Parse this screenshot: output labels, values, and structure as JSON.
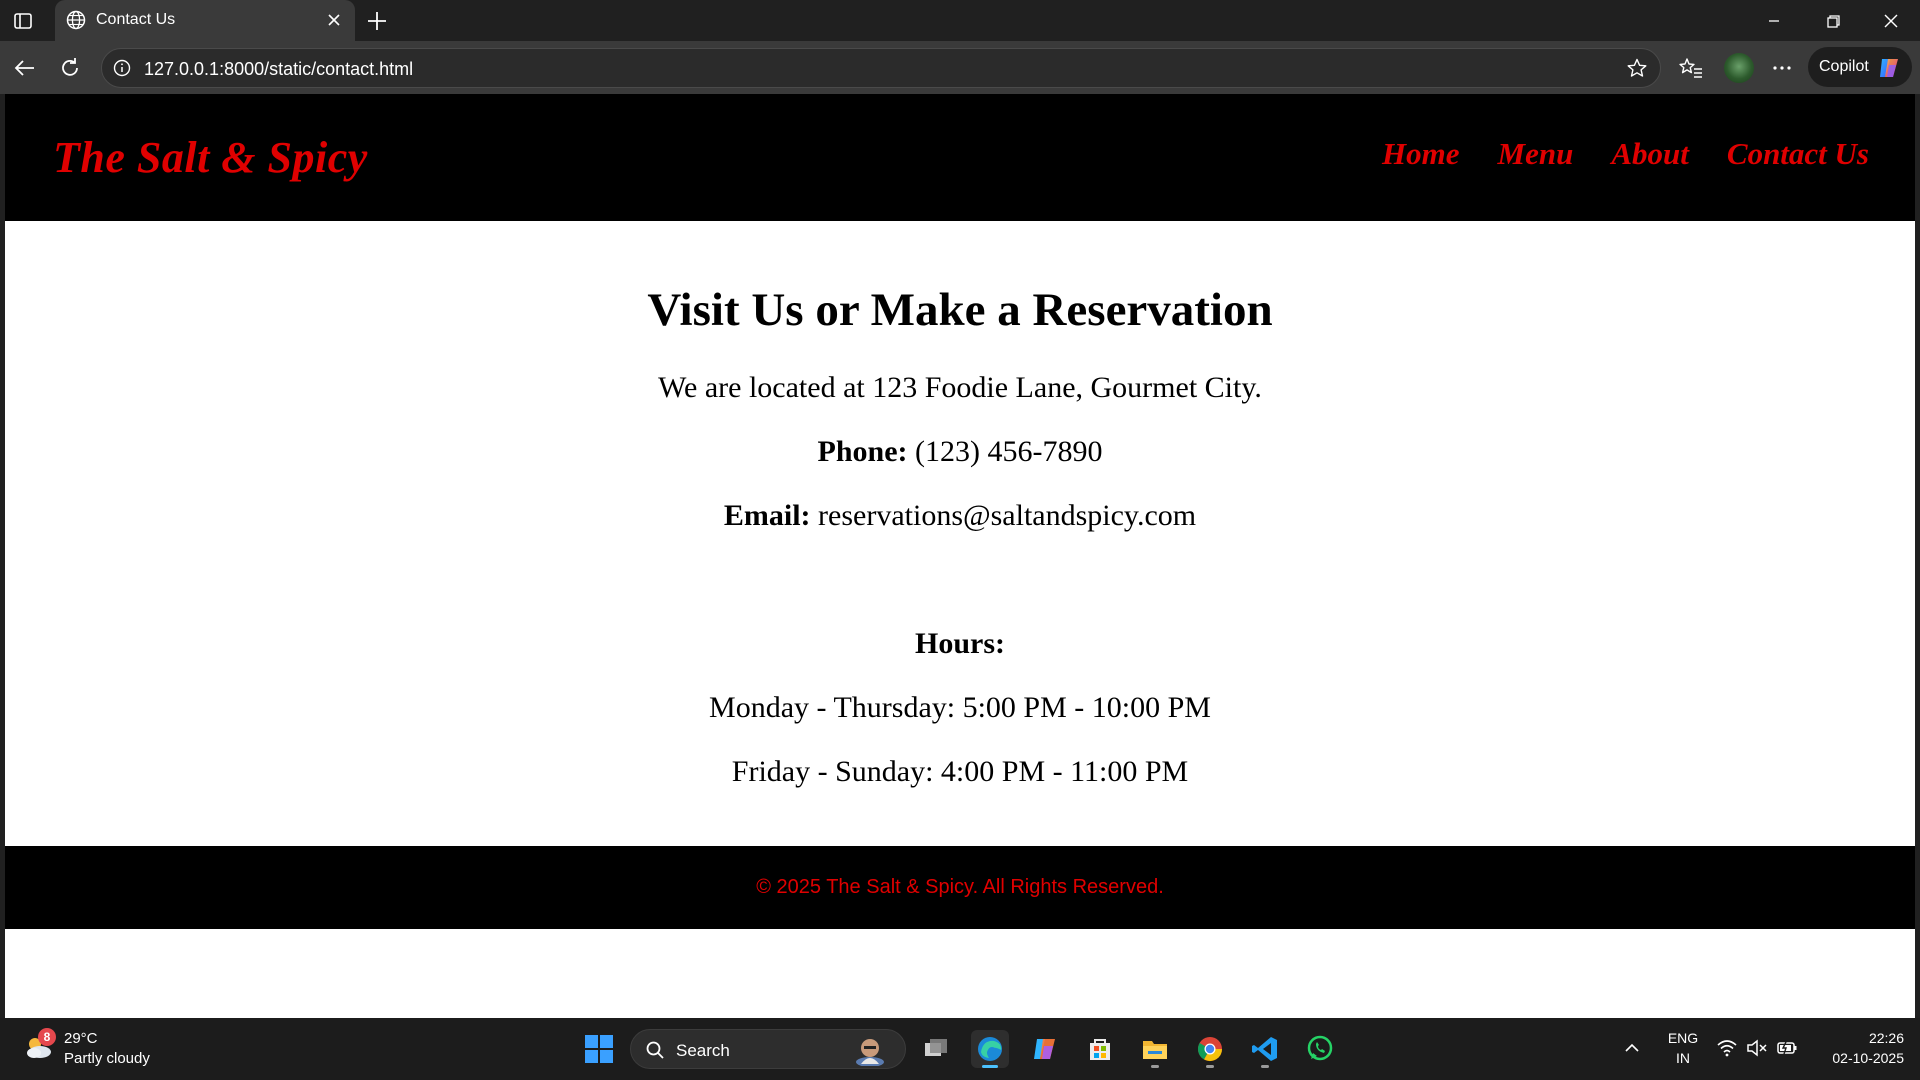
{
  "browser": {
    "tab_title": "Contact Us",
    "url": "127.0.0.1:8000/static/contact.html",
    "copilot_label": "Copilot"
  },
  "site": {
    "logo": "The Salt & Spicy",
    "nav": [
      "Home",
      "Menu",
      "About",
      "Contact Us"
    ],
    "brand_color": "#e00000"
  },
  "content": {
    "heading": "Visit Us or Make a Reservation",
    "location": "We are located at 123 Foodie Lane, Gourmet City.",
    "phone_label": "Phone:",
    "phone_value": "(123) 456-7890",
    "email_label": "Email:",
    "email_value": "reservations@saltandspicy.com",
    "hours_label": "Hours:",
    "hours": [
      "Monday - Thursday: 5:00 PM - 10:00 PM",
      "Friday - Sunday: 4:00 PM - 11:00 PM"
    ]
  },
  "footer": {
    "text": "© 2025 The Salt & Spicy. All Rights Reserved."
  },
  "taskbar": {
    "weather_badge": "8",
    "weather_temp": "29°C",
    "weather_desc": "Partly cloudy",
    "search_label": "Search",
    "lang_line1": "ENG",
    "lang_line2": "IN",
    "time": "22:26",
    "date": "02-10-2025"
  }
}
